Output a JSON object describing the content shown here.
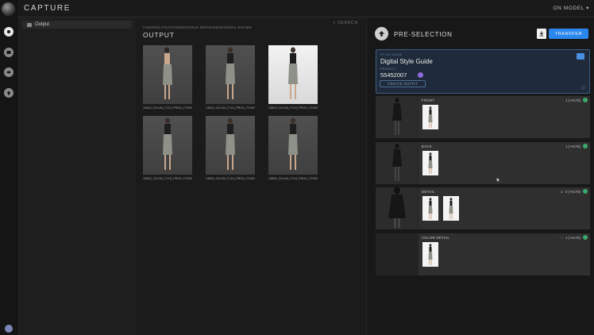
{
  "app": {
    "title": "CAPTURE",
    "mode": "ON MODEL"
  },
  "sidebar": {
    "folder": "Output"
  },
  "gallery": {
    "search_label": "SEARCH",
    "path": "/USERS/LITEASTEN/GOOGLE DRIVE/SESSIONS/L EXAMS",
    "heading": "OUTPUT",
    "images": [
      {
        "caption": "13843_OLV-64_FL19_PRGU_F19021-W..."
      },
      {
        "caption": "13843_OLV-64_FL19_PRGU_F19021-W..."
      },
      {
        "caption": "13843_OLV-64_FL19_PRGU_F19021-W..."
      },
      {
        "caption": "13843_OLV-64_FL19_PRGU_F19021-W..."
      },
      {
        "caption": "13843_OLV-64_FL19_PRGU_F19021-W..."
      },
      {
        "caption": "13843_OLV-64_FL19_PRGU_F19021-W..."
      }
    ]
  },
  "preselection": {
    "title": "PRE-SELECTION",
    "transfer_label": "TRANSFER",
    "style_guide": {
      "label": "STYLE GUIDE",
      "value": "Digital Style Guide",
      "product_label": "PRODUCT",
      "product_value": "55452007",
      "create_outfit_label": "CREATE OUTFIT"
    },
    "shots": [
      {
        "label": "FRONT",
        "count": "1 (+ALTS)"
      },
      {
        "label": "BACK",
        "count": "1 (+ALTS)"
      },
      {
        "label": "DETAIL",
        "count": "1 - 2 (+ALTS)"
      },
      {
        "label": "COLOR DETAIL",
        "count": "1 (+ALTS)",
        "menu": "..."
      }
    ]
  },
  "colors": {
    "accent": "#2a87ee",
    "check": "#3aa96b",
    "badge": "#8e6bdc"
  }
}
